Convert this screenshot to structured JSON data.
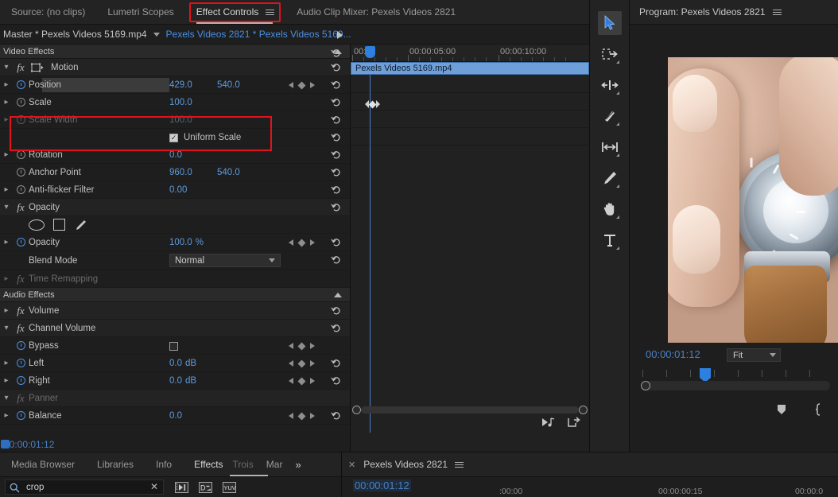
{
  "colors": {
    "accent_blue": "#4a90e2",
    "value_blue": "#5d9bdd",
    "highlight_red": "#e1121b",
    "clip_bar": "#6f9fd8",
    "panel_bg": "#1e1e1e",
    "tab_bg": "#232323"
  },
  "effect_controls": {
    "tabs": [
      {
        "label": "Source: (no clips)",
        "active": false
      },
      {
        "label": "Lumetri Scopes",
        "active": false
      },
      {
        "label": "Effect Controls",
        "active": true
      },
      {
        "label": "Audio Clip Mixer: Pexels Videos 2821",
        "active": false
      }
    ],
    "menu_icon": "hamburger-menu-icon",
    "master_clip": "Master * Pexels Videos 5169.mp4",
    "sequence_clip": "Pexels Videos 2821 * Pexels Videos 5169...",
    "video_effects_header": "Video Effects",
    "audio_effects_header": "Audio Effects",
    "video_effects": [
      {
        "name": "Motion",
        "type": "group",
        "disclosure": "open",
        "fx_icon": "fx-icon",
        "transform_icon": "transform-box-icon",
        "reset_icon": "reset-icon",
        "highlighted": true
      },
      {
        "name": "Position",
        "type": "param",
        "disclosure": "closed",
        "stopwatch": "on",
        "values": [
          "429.0",
          "540.0"
        ],
        "keyframe_nav": true,
        "reset_icon": "reset-icon",
        "highlighted": true,
        "field_focused": true
      },
      {
        "name": "Scale",
        "type": "param",
        "disclosure": "closed",
        "stopwatch": "off",
        "values": [
          "100.0"
        ],
        "reset_icon": "reset-icon"
      },
      {
        "name": "Scale Width",
        "type": "param",
        "disclosure": "closed",
        "stopwatch": "off",
        "values": [
          "100.0"
        ],
        "disabled": true,
        "reset_icon": "reset-icon"
      },
      {
        "name": "Uniform Scale",
        "type": "checkbox",
        "checked": true,
        "reset_icon": "reset-icon"
      },
      {
        "name": "Rotation",
        "type": "param",
        "disclosure": "closed",
        "stopwatch": "off",
        "values": [
          "0.0"
        ],
        "reset_icon": "reset-icon"
      },
      {
        "name": "Anchor Point",
        "type": "param",
        "stopwatch": "off",
        "values": [
          "960.0",
          "540.0"
        ],
        "reset_icon": "reset-icon"
      },
      {
        "name": "Anti-flicker Filter",
        "type": "param",
        "disclosure": "closed",
        "stopwatch": "off",
        "values": [
          "0.00"
        ],
        "reset_icon": "reset-icon"
      },
      {
        "name": "Opacity",
        "type": "group",
        "disclosure": "open",
        "fx_icon": "fx-icon",
        "reset_icon": "reset-icon"
      },
      {
        "name": "mask-tools",
        "type": "masktools",
        "tools": [
          "ellipse-mask-icon",
          "rectangle-mask-icon",
          "pen-mask-icon"
        ],
        "reset_icon": "reset-icon"
      },
      {
        "name": "Opacity",
        "type": "param",
        "disclosure": "closed",
        "stopwatch": "on",
        "values": [
          "100.0"
        ],
        "unit": "%",
        "keyframe_nav": true,
        "reset_icon": "reset-icon"
      },
      {
        "name": "Blend Mode",
        "type": "select",
        "selected": "Normal",
        "options": [
          "Normal"
        ],
        "reset_icon": "reset-icon"
      },
      {
        "name": "Time Remapping",
        "type": "group",
        "disclosure": "closed",
        "fx_icon": "fx-icon",
        "disabled": true
      }
    ],
    "audio_effects": [
      {
        "name": "Volume",
        "type": "group",
        "disclosure": "closed",
        "fx_icon": "fx-icon",
        "reset_icon": "reset-icon"
      },
      {
        "name": "Channel Volume",
        "type": "group",
        "disclosure": "open",
        "fx_icon": "fx-icon",
        "reset_icon": "reset-icon"
      },
      {
        "name": "Bypass",
        "type": "checkbox-param",
        "stopwatch": "on",
        "checked": false,
        "keyframe_nav": true
      },
      {
        "name": "Left",
        "type": "param",
        "disclosure": "closed",
        "stopwatch": "on",
        "values": [
          "0.0"
        ],
        "unit": "dB",
        "keyframe_nav": true,
        "reset_icon": "reset-icon"
      },
      {
        "name": "Right",
        "type": "param",
        "disclosure": "closed",
        "stopwatch": "on",
        "values": [
          "0.0"
        ],
        "unit": "dB",
        "keyframe_nav": true,
        "reset_icon": "reset-icon"
      },
      {
        "name": "Panner",
        "type": "group",
        "disclosure": "open",
        "fx_icon": "fx-icon",
        "disabled": true
      },
      {
        "name": "Balance",
        "type": "param",
        "disclosure": "closed",
        "stopwatch": "on",
        "values": [
          "0.0"
        ],
        "keyframe_nav": true,
        "reset_icon": "reset-icon"
      }
    ],
    "timeline": {
      "ruler_labels": [
        "00:00",
        "00:00:05:00",
        "00:00:10:00"
      ],
      "clip_name": "Pexels Videos 5169.mp4",
      "playhead_position": "00:00",
      "keyframe_marker": "keyframe-navigator-icon"
    },
    "bottom_timecode": "00:00:01:12"
  },
  "toolbar": {
    "tools": [
      {
        "name": "selection-tool-icon",
        "label": "Selection Tool",
        "active": true
      },
      {
        "name": "track-select-forward-tool-icon",
        "label": "Track Select Forward Tool",
        "active": false
      },
      {
        "name": "ripple-edit-tool-icon",
        "label": "Ripple Edit Tool",
        "active": false
      },
      {
        "name": "razor-tool-icon",
        "label": "Razor Tool",
        "active": false
      },
      {
        "name": "slip-tool-icon",
        "label": "Slip Tool",
        "active": false
      },
      {
        "name": "pen-tool-icon",
        "label": "Pen Tool",
        "active": false
      },
      {
        "name": "hand-tool-icon",
        "label": "Hand Tool",
        "active": false
      },
      {
        "name": "type-tool-icon",
        "label": "Type Tool",
        "active": false
      }
    ]
  },
  "program_monitor": {
    "title": "Program: Pexels Videos 2821",
    "menu_icon": "hamburger-menu-icon",
    "timecode": "00:00:01:12",
    "zoom_level": "Fit",
    "zoom_options": [
      "Fit"
    ],
    "buttons": [
      "mark-in-icon",
      "mark-out-icon"
    ],
    "video_description": "close-up of hand adjusting silver wristwatch with brown leather band"
  },
  "bottom_left_panel": {
    "tabs": [
      {
        "label": "Media Browser",
        "active": false
      },
      {
        "label": "Libraries",
        "active": false
      },
      {
        "label": "Info",
        "active": false
      },
      {
        "label": "Effects",
        "active": true
      },
      {
        "label": "Trois",
        "active": false,
        "dim": true
      },
      {
        "label": "Mar",
        "active": false
      }
    ],
    "overflow_icon": "double-chevron-right-icon",
    "search": {
      "value": "crop",
      "placeholder": "",
      "search_icon": "search-icon",
      "clear_icon": "close-x-icon"
    },
    "filter_icons": [
      "accelerated-effects-icon",
      "32-bit-color-icon",
      "yuv-effects-icon"
    ]
  },
  "bottom_right_panel": {
    "close_icon": "close-x-icon",
    "title": "Pexels Videos 2821",
    "menu_icon": "hamburger-menu-icon",
    "timecode": "00:00:01:12",
    "ruler_labels": [
      ":00:00",
      "00:00:00:15",
      "00:00:0"
    ]
  }
}
